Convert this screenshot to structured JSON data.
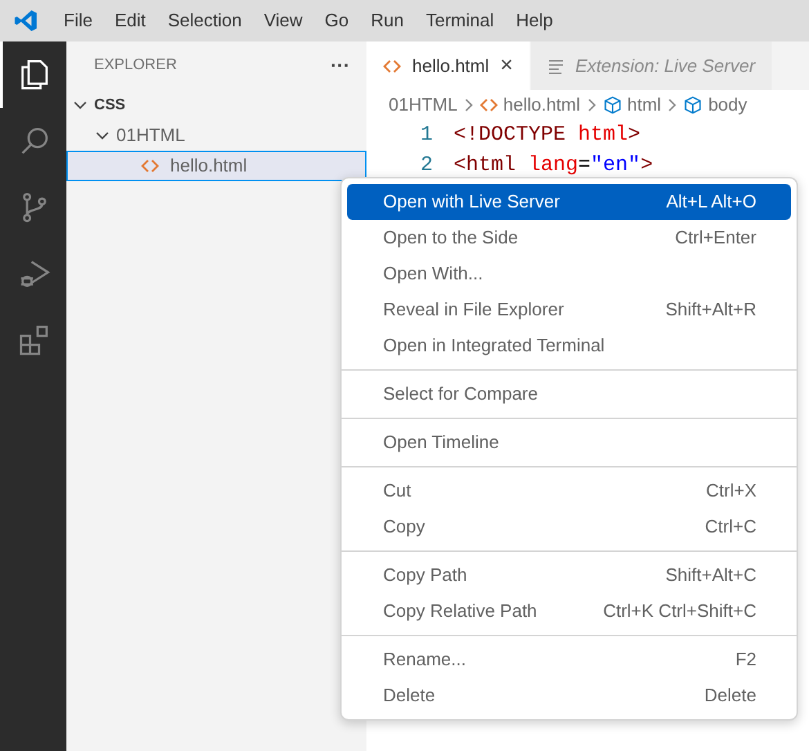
{
  "menu_bar": [
    "File",
    "Edit",
    "Selection",
    "View",
    "Go",
    "Run",
    "Terminal",
    "Help"
  ],
  "activity_bar": [
    {
      "kind": "files",
      "selected": true
    },
    {
      "kind": "search",
      "selected": false
    },
    {
      "kind": "scm",
      "selected": false
    },
    {
      "kind": "debug",
      "selected": false
    },
    {
      "kind": "extensions",
      "selected": false
    }
  ],
  "sidebar": {
    "title": "EXPLORER",
    "more": "···",
    "tree": [
      {
        "label": "CSS",
        "kind": "root",
        "children": [
          {
            "label": "01HTML",
            "kind": "folder",
            "children": [
              {
                "label": "hello.html",
                "kind": "file",
                "selected": true
              }
            ]
          }
        ]
      }
    ]
  },
  "tabs": [
    {
      "label": "hello.html",
      "kind": "html",
      "selected": true,
      "close": "×"
    },
    {
      "label": "Extension: Live Server",
      "kind": "preview",
      "selected": false
    }
  ],
  "breadcrumb": [
    {
      "label": "01HTML",
      "kind": "folder"
    },
    {
      "label": "hello.html",
      "kind": "html"
    },
    {
      "label": "html",
      "kind": "element"
    },
    {
      "label": "body",
      "kind": "element"
    }
  ],
  "code": [
    {
      "number": "1",
      "tokens": [
        {
          "text": "<!DOCTYPE ",
          "kind": "tag"
        },
        {
          "text": "html",
          "kind": "attr"
        },
        {
          "text": ">",
          "kind": "tag"
        }
      ]
    },
    {
      "number": "2",
      "tokens": [
        {
          "text": "<html ",
          "kind": "tag"
        },
        {
          "text": "lang",
          "kind": "attr"
        },
        {
          "text": "=",
          "kind": "plain"
        },
        {
          "text": "\"en\"",
          "kind": "value"
        },
        {
          "text": ">",
          "kind": "tag"
        }
      ]
    }
  ],
  "context_menu": [
    [
      {
        "label": "Open with Live Server",
        "shortcut": "Alt+L Alt+O",
        "selected": true
      },
      {
        "label": "Open to the Side",
        "shortcut": "Ctrl+Enter",
        "selected": false
      },
      {
        "label": "Open With...",
        "selected": false
      },
      {
        "label": "Reveal in File Explorer",
        "shortcut": "Shift+Alt+R",
        "selected": false
      },
      {
        "label": "Open in Integrated Terminal",
        "selected": false
      }
    ],
    [
      {
        "label": "Select for Compare",
        "selected": false
      }
    ],
    [
      {
        "label": "Open Timeline",
        "selected": false
      }
    ],
    [
      {
        "label": "Cut",
        "shortcut": "Ctrl+X",
        "selected": false
      },
      {
        "label": "Copy",
        "shortcut": "Ctrl+C",
        "selected": false
      }
    ],
    [
      {
        "label": "Copy Path",
        "shortcut": "Shift+Alt+C",
        "selected": false
      },
      {
        "label": "Copy Relative Path",
        "shortcut": "Ctrl+K Ctrl+Shift+C",
        "selected": false
      }
    ],
    [
      {
        "label": "Rename...",
        "shortcut": "F2",
        "selected": false
      },
      {
        "label": "Delete",
        "shortcut": "Delete",
        "selected": false
      }
    ]
  ]
}
